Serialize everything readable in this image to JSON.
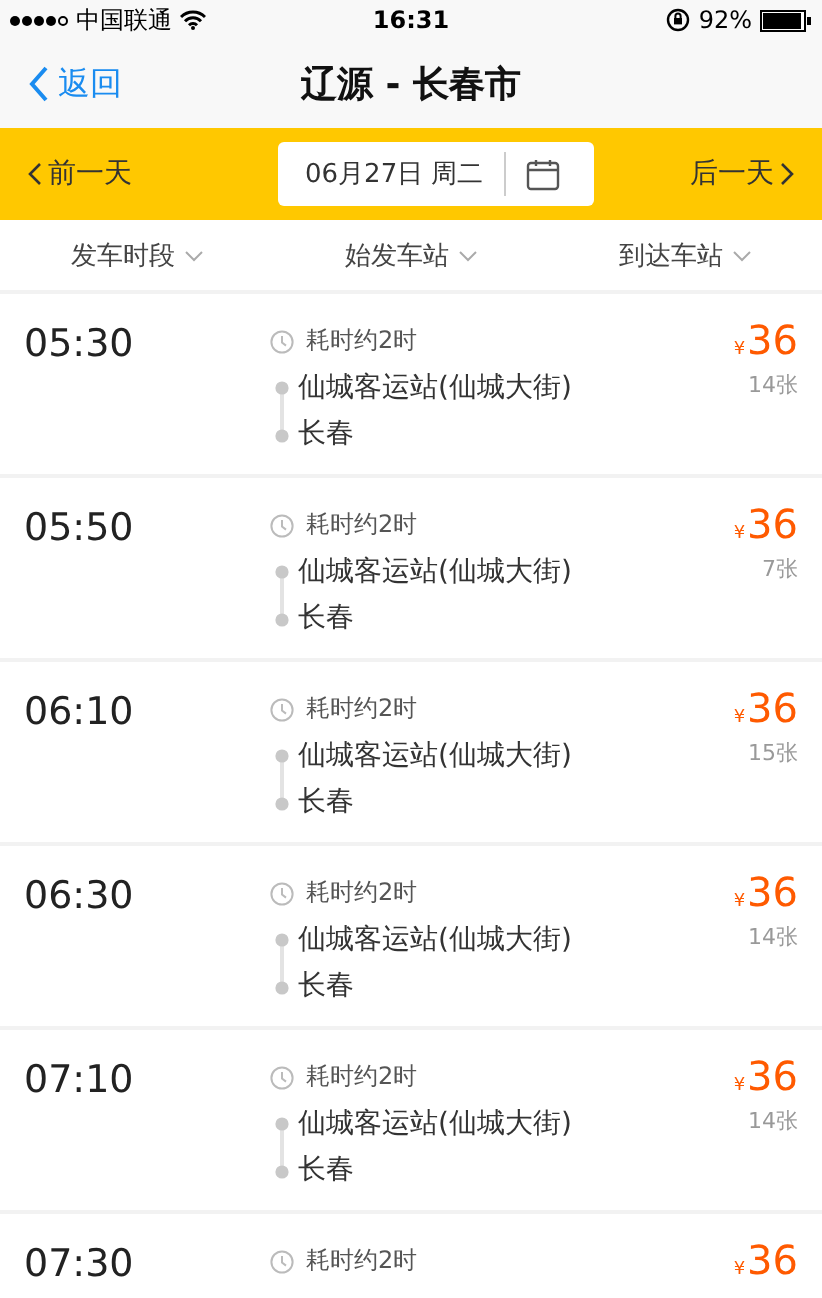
{
  "status_bar": {
    "carrier": "中国联通",
    "time": "16:31",
    "battery": "92%"
  },
  "nav": {
    "back": "返回",
    "title": "辽源 - 长春市"
  },
  "date_bar": {
    "prev": "前一天",
    "date": "06月27日 周二",
    "next": "后一天"
  },
  "filters": [
    "发车时段",
    "始发车站",
    "到达车站"
  ],
  "trips": [
    {
      "time": "05:30",
      "duration": "耗时约2时",
      "from": "仙城客运站(仙城大街)",
      "to": "长春",
      "currency": "¥",
      "price": "36",
      "tickets": "14张"
    },
    {
      "time": "05:50",
      "duration": "耗时约2时",
      "from": "仙城客运站(仙城大街)",
      "to": "长春",
      "currency": "¥",
      "price": "36",
      "tickets": "7张"
    },
    {
      "time": "06:10",
      "duration": "耗时约2时",
      "from": "仙城客运站(仙城大街)",
      "to": "长春",
      "currency": "¥",
      "price": "36",
      "tickets": "15张"
    },
    {
      "time": "06:30",
      "duration": "耗时约2时",
      "from": "仙城客运站(仙城大街)",
      "to": "长春",
      "currency": "¥",
      "price": "36",
      "tickets": "14张"
    },
    {
      "time": "07:10",
      "duration": "耗时约2时",
      "from": "仙城客运站(仙城大街)",
      "to": "长春",
      "currency": "¥",
      "price": "36",
      "tickets": "14张"
    },
    {
      "time": "07:30",
      "duration": "耗时约2时",
      "currency": "¥",
      "price": "36"
    }
  ]
}
